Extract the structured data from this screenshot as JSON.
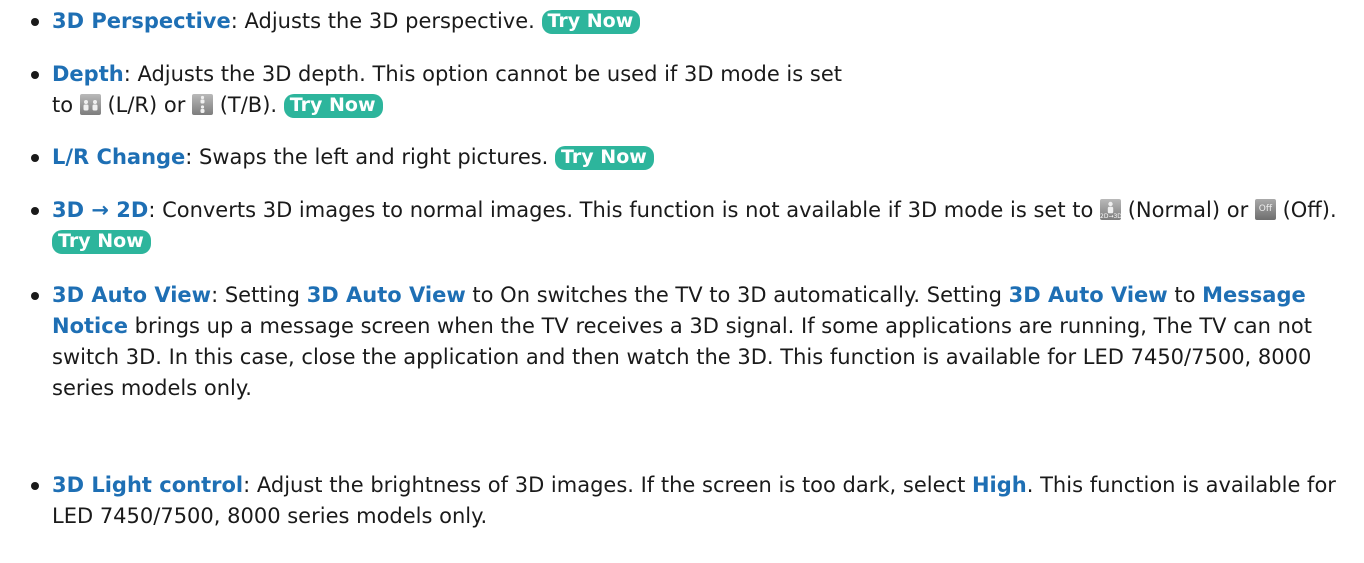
{
  "colors": {
    "term": "#1e6fb4",
    "try_now_bg": "#2db59c",
    "bullet": "#1a1a1a"
  },
  "try_now": "Try Now",
  "items": [
    {
      "term": "3D Perspective",
      "text": ": Adjusts the 3D perspective. "
    },
    {
      "term": "Depth",
      "text1": ": Adjusts the 3D depth. This option cannot be used if 3D mode is set to ",
      "icon1": "side-by-side-persons-icon",
      "text2": " (L/R) or ",
      "icon2": "top-bottom-persons-icon",
      "text3": " (T/B). "
    },
    {
      "term": "L/R Change",
      "text": ": Swaps the left and right pictures. "
    },
    {
      "term": "3D → 2D",
      "text1": ": Converts 3D images to normal images. This function is not available if 3D mode is set to ",
      "icon1": "2d-to-3d-person-icon",
      "icon1_caption": "2D→3D",
      "text2": " (Normal) or ",
      "icon2": "off-icon",
      "icon2_caption": "Off",
      "text3": " (Off). "
    },
    {
      "term": "3D Auto View",
      "text1": ": Setting ",
      "term2": "3D Auto View",
      "text2": " to On switches the TV to 3D automatically. Setting ",
      "term3": "3D Auto View",
      "text3": " to ",
      "term4": "Message Notice",
      "text4": " brings up a message screen when the TV receives a 3D signal. If some applications are running, The TV can not switch 3D. In this case, close the application and then watch the 3D. This function is available for LED 7450/7500, 8000 series models only."
    },
    {
      "term": "3D Light control",
      "text1": ": Adjust the brightness of 3D images. If the screen is too dark, select ",
      "term2": "High",
      "text2": ". This function is available for LED 7450/7500, 8000 series models only."
    }
  ]
}
